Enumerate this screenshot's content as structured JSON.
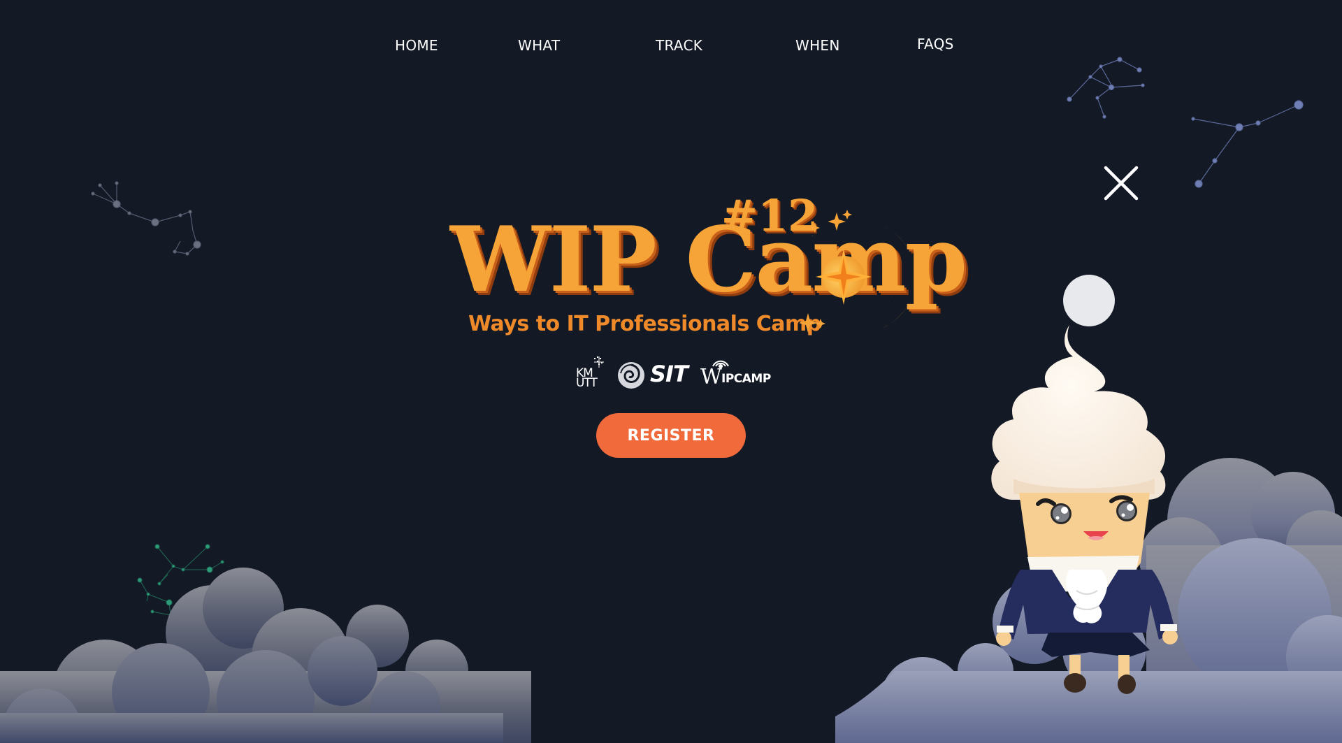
{
  "nav": {
    "home": "HOME",
    "what": "WHAT",
    "track": "TRACK",
    "when": "WHEN",
    "faqs": "FAQS"
  },
  "logo": {
    "main": "WIP Camp",
    "number": "#12",
    "subtitle": "Ways to IT Professionals Camp"
  },
  "sponsors": {
    "kmutt_top": "KM",
    "kmutt_bottom": "UTT",
    "sit": "SIT",
    "wipcamp_w": "W",
    "wipcamp_rest": "IPCAMP"
  },
  "register": {
    "label": "REGISTER"
  },
  "icons": {
    "close": "close-icon",
    "sun": "sun-icon",
    "mascot": "ice-cream-mascot"
  },
  "colors": {
    "background": "#141926",
    "accent": "#f06a3c",
    "logo": "#f6a437",
    "cloud": "#5d6580"
  }
}
